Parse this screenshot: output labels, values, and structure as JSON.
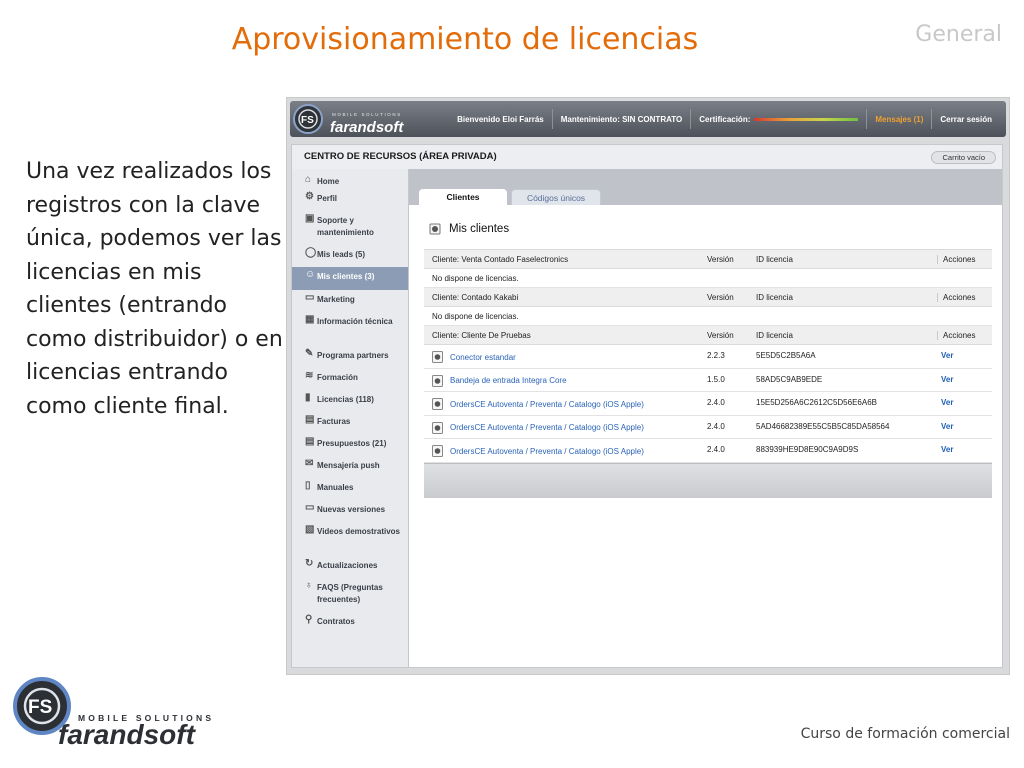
{
  "slide": {
    "title": "Aprovisionamiento de licencias",
    "tag": "General",
    "body": "Una vez realizados los registros con la clave única, podemos ver las licencias en mis clientes (entrando como distribuidor) o en licencias entrando como cliente final.",
    "footer": "Curso de formación comercial",
    "logo_top": "MOBILE SOLUTIONS",
    "logo_bottom": "farandsoft",
    "logo_mark": "FS"
  },
  "topbar": {
    "welcome": "Bienvenido Eloi Farrás",
    "maintenance": "Mantenimiento:  SIN CONTRATO",
    "certification": "Certificación:",
    "messages": "Mensajes (1)",
    "logout": "Cerrar sesión"
  },
  "header": {
    "title": "CENTRO DE RECURSOS (ÁREA PRIVADA)",
    "cart": "Carrito vacío"
  },
  "sidebar": {
    "items": [
      {
        "label": "Home",
        "icon": "home-icon",
        "glyph": "⌂"
      },
      {
        "label": "Perfil",
        "icon": "gear-icon",
        "glyph": "⚙"
      },
      {
        "label": "Soporte y mantenimiento",
        "icon": "monitor-icon",
        "glyph": "▣"
      },
      {
        "label": "Mis leads (5)",
        "icon": "speech-bubble-icon",
        "glyph": "◯"
      },
      {
        "label": "Mis clientes (3)",
        "icon": "users-icon",
        "glyph": "☺",
        "active": true
      },
      {
        "label": "Marketing",
        "icon": "briefcase-icon",
        "glyph": "▭"
      },
      {
        "label": "Información técnica",
        "icon": "chart-icon",
        "glyph": "▦"
      },
      {
        "label": "Programa partners",
        "icon": "pencil-icon",
        "glyph": "✎"
      },
      {
        "label": "Formación",
        "icon": "graduation-cap-icon",
        "glyph": "≋"
      },
      {
        "label": "Licencias (118)",
        "icon": "phone-icon",
        "glyph": "▮"
      },
      {
        "label": "Facturas",
        "icon": "invoice-icon",
        "glyph": "▤"
      },
      {
        "label": "Presupuestos (21)",
        "icon": "budget-icon",
        "glyph": "▤"
      },
      {
        "label": "Mensajería push",
        "icon": "envelope-icon",
        "glyph": "✉"
      },
      {
        "label": "Manuales",
        "icon": "document-icon",
        "glyph": "▯"
      },
      {
        "label": "Nuevas versiones",
        "icon": "folder-icon",
        "glyph": "▭"
      },
      {
        "label": "Videos demostrativos",
        "icon": "video-icon",
        "glyph": "▧"
      },
      {
        "label": "Actualizaciones",
        "icon": "refresh-icon",
        "glyph": "↻"
      },
      {
        "label": "FAQS (Preguntas frecuentes)",
        "icon": "lightbulb-icon",
        "glyph": "♁"
      },
      {
        "label": "Contratos",
        "icon": "wrench-icon",
        "glyph": "⚲"
      }
    ]
  },
  "tabs": [
    {
      "label": "Clientes"
    },
    {
      "label": "Códigos únicos"
    }
  ],
  "section_title": "Mis clientes",
  "table": {
    "col_version": "Versión",
    "col_id": "ID licencia",
    "col_actions": "Acciones",
    "groups": [
      {
        "client": "Cliente: Venta Contado Faselectronics",
        "empty": "No dispone de licencias.",
        "rows": []
      },
      {
        "client": "Cliente: Contado Kakabi",
        "empty": "No dispone de licencias.",
        "rows": []
      },
      {
        "client": "Cliente: Cliente De Pruebas",
        "empty": "",
        "rows": [
          {
            "product": "Conector estandar",
            "version": "2.2.3",
            "id": "5E5D5C2B5A6A",
            "action": "Ver"
          },
          {
            "product": "Bandeja de entrada Integra Core",
            "version": "1.5.0",
            "id": "58AD5C9AB9EDE",
            "action": "Ver"
          },
          {
            "product": "OrdersCE Autoventa / Preventa / Catalogo (iOS Apple)",
            "version": "2.4.0",
            "id": "15E5D256A6C2612C5D56E6A6B",
            "action": "Ver"
          },
          {
            "product": "OrdersCE Autoventa / Preventa / Catalogo (iOS Apple)",
            "version": "2.4.0",
            "id": "5AD46682389E55C5B5C85DA58564",
            "action": "Ver"
          },
          {
            "product": "OrdersCE Autoventa / Preventa / Catalogo (iOS Apple)",
            "version": "2.4.0",
            "id": "883939HE9D8E90C9A9D9S",
            "action": "Ver"
          }
        ]
      }
    ]
  },
  "colors": {
    "title_orange": "#e36c0a",
    "sidebar_active": "#8c9cb4",
    "link_blue": "#2a63b8"
  }
}
